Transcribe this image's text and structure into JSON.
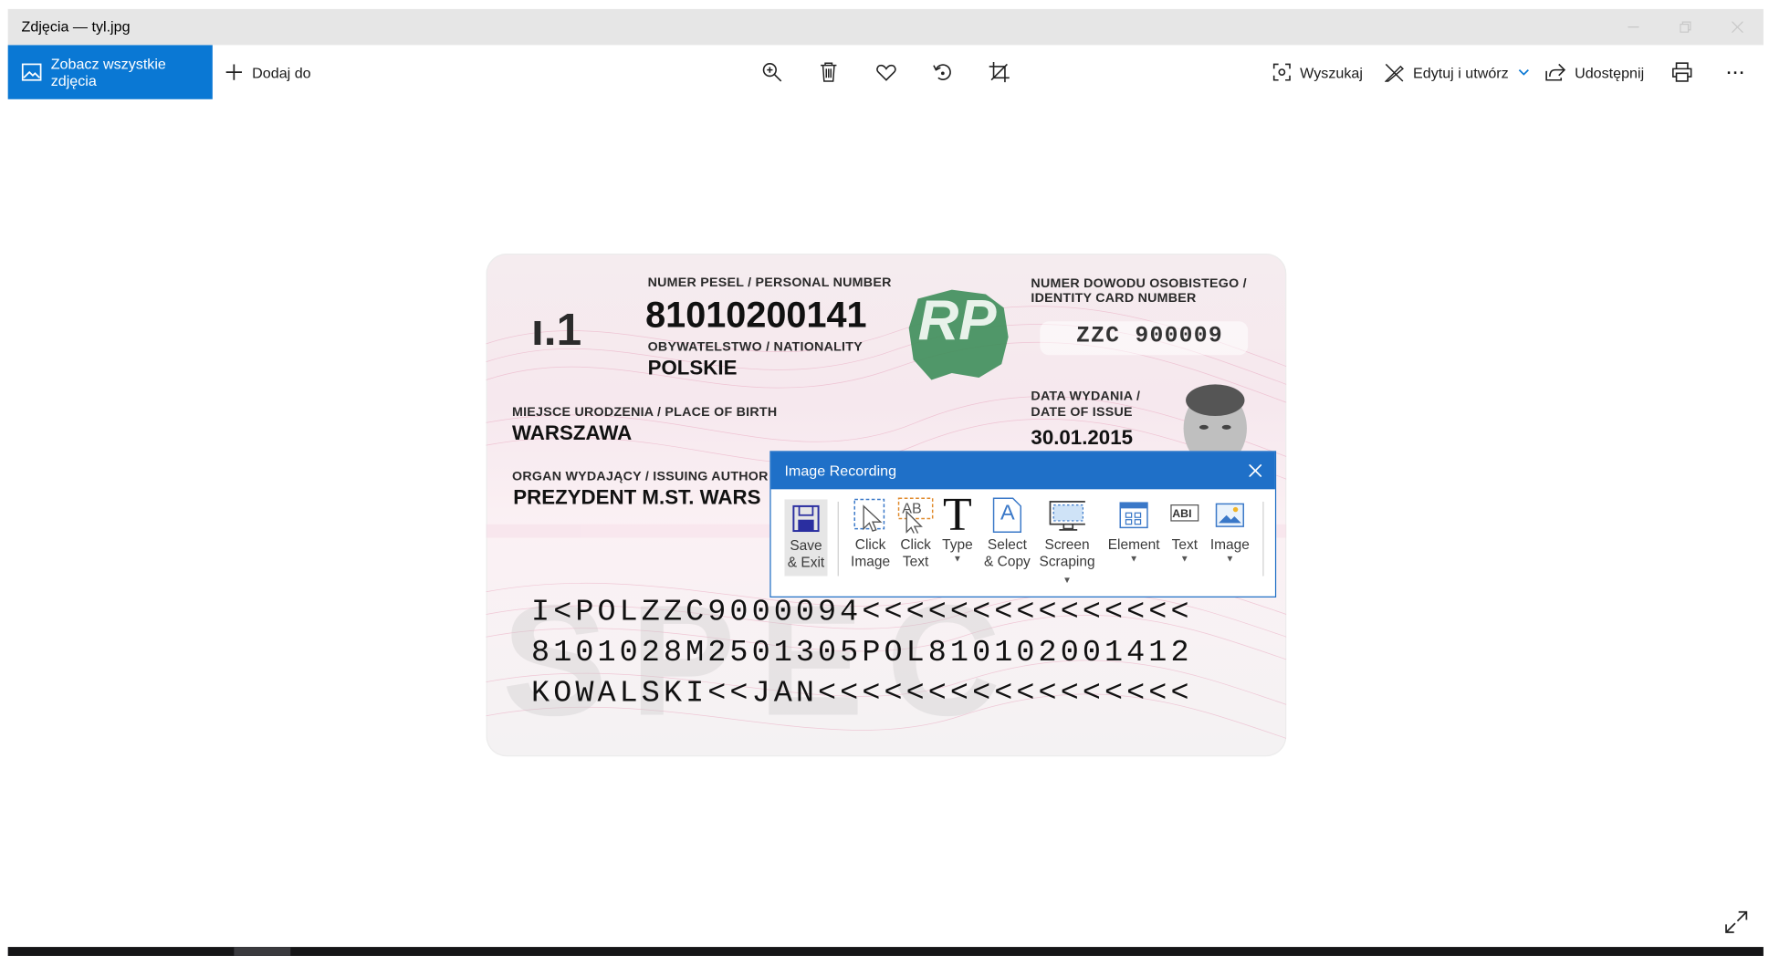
{
  "window": {
    "title": "Zdjęcia — tyl.jpg"
  },
  "toolbar": {
    "see_all_label": "Zobacz wszystkie zdjęcia",
    "add_to_label": "Dodaj do",
    "search_label": "Wyszukaj",
    "edit_label": "Edytuj i utwórz",
    "share_label": "Udostępnij",
    "more_label": "···"
  },
  "card": {
    "pesel_label": "NUMER PESEL / PERSONAL NUMBER",
    "pesel_value": "81010200141",
    "can_fragment": "ı.1",
    "nationality_label": "OBYWATELSTWO / NATIONALITY",
    "nationality_value": "POLSKIE",
    "rp_logo": "RP",
    "idno_label_1": "NUMER DOWODU OSOBISTEGO /",
    "idno_label_2": "IDENTITY CARD NUMBER",
    "idno_value": "ZZC 900009",
    "birth_label": "MIEJSCE URODZENIA / PLACE OF BIRTH",
    "birth_value": "WARSZAWA",
    "issue_label_1": "DATA WYDANIA /",
    "issue_label_2": "DATE OF ISSUE",
    "issue_value": "30.01.2015",
    "authority_label": "ORGAN WYDAJĄCY / ISSUING AUTHOR",
    "authority_value": "PREZYDENT M.ST. WARS",
    "ghost_text": "SPEC",
    "mrz": [
      "I<POLZZC9000094<<<<<<<<<<<<<<<",
      "8101028M2501305POL810102001412",
      "KOWALSKI<<JAN<<<<<<<<<<<<<<<<<"
    ]
  },
  "dialog": {
    "title": "Image Recording",
    "buttons": {
      "save_1": "Save",
      "save_2": "& Exit",
      "click_image_1": "Click",
      "click_image_2": "Image",
      "click_text_1": "Click",
      "click_text_2": "Text",
      "type": "Type",
      "select_copy_1": "Select",
      "select_copy_2": "& Copy",
      "screen_scraping_1": "Screen",
      "screen_scraping_2": "Scraping",
      "element": "Element",
      "text": "Text",
      "image": "Image"
    },
    "icon_text_ab": "AB",
    "icon_text_abi": "ABI",
    "icon_text_t": "T",
    "icon_text_a": "A"
  },
  "colors": {
    "accent": "#0a78d4",
    "dialog_header": "#1f70c8",
    "titlebar": "#e6e6e6"
  }
}
